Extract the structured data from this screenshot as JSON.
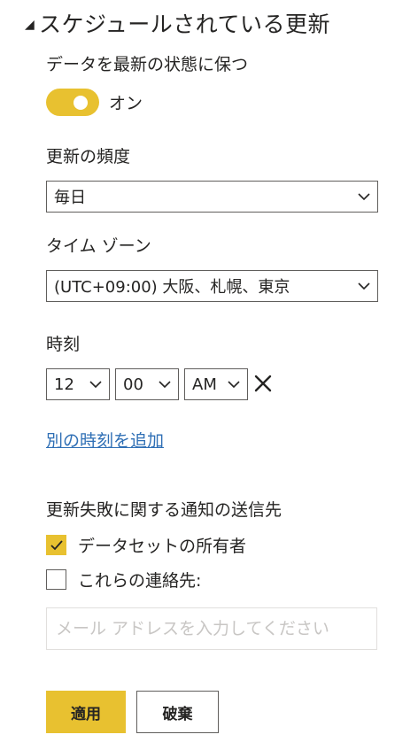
{
  "section": {
    "title": "スケジュールされている更新",
    "expanded": true
  },
  "keep_updated": {
    "label": "データを最新の状態に保つ",
    "toggle_on": true,
    "state_label": "オン"
  },
  "frequency": {
    "label": "更新の頻度",
    "value": "毎日"
  },
  "timezone": {
    "label": "タイム ゾーン",
    "value": "(UTC+09:00) 大阪、札幌、東京"
  },
  "time": {
    "label": "時刻",
    "hour": "12",
    "minute": "00",
    "period": "AM",
    "add_link": "別の時刻を追加"
  },
  "notify": {
    "label": "更新失敗に関する通知の送信先",
    "owner_label": "データセットの所有者",
    "owner_checked": true,
    "contacts_label": "これらの連絡先:",
    "contacts_checked": false,
    "email_placeholder": "メール アドレスを入力してください",
    "email_value": ""
  },
  "actions": {
    "apply": "適用",
    "discard": "破棄"
  },
  "colors": {
    "accent": "#e8c130",
    "link": "#2f6fb5",
    "border": "#605e5c"
  }
}
